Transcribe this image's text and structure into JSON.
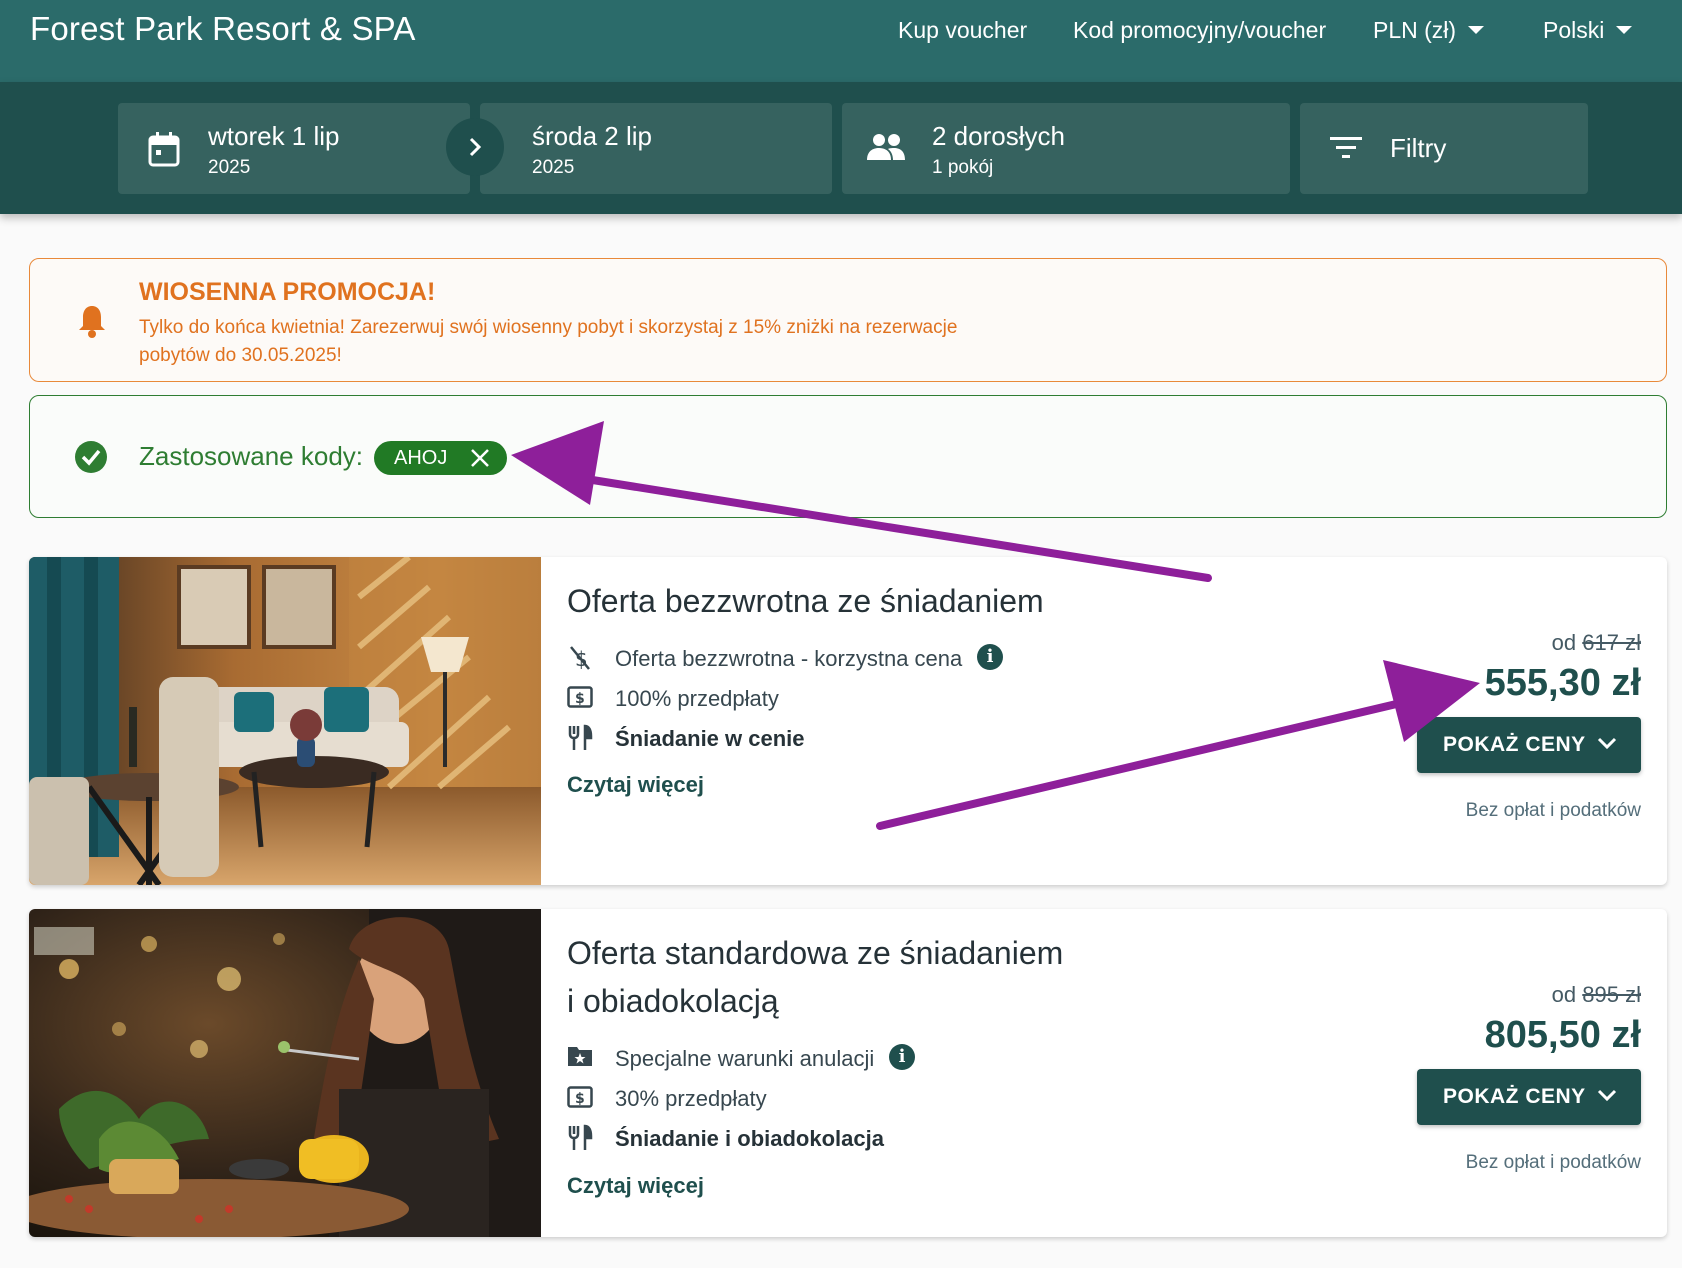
{
  "header": {
    "brand": "Forest Park Resort & SPA",
    "links": [
      "Kup voucher",
      "Kod promocyjny/voucher"
    ],
    "currency": "PLN (zł)",
    "language": "Polski"
  },
  "search": {
    "checkin_day": "wtorek 1 lip",
    "checkin_year": "2025",
    "checkout_day": "środa 2 lip",
    "checkout_year": "2025",
    "guests": "2 dorosłych",
    "rooms": "1 pokój",
    "filters": "Filtry"
  },
  "promo": {
    "title": "WIOSENNA PROMOCJA!",
    "text": "Tylko do końca kwietnia! Zarezerwuj swój wiosenny pobyt i skorzystaj z 15% zniżki na rezerwacje pobytów do 30.05.2025!",
    "color": "#e0721f"
  },
  "codes": {
    "label": "Zastosowane kody:",
    "chip": "AHOJ",
    "color": "#2e7d32"
  },
  "offers": [
    {
      "title": "Oferta bezzwrotna ze śniadaniem",
      "features": [
        {
          "icon": "no-refund-icon",
          "text": "Oferta bezzwrotna - korzystna cena",
          "info": "i"
        },
        {
          "icon": "prepayment-icon",
          "text": "100% przedpłaty"
        },
        {
          "icon": "cutlery-icon",
          "text": "Śniadanie w cenie"
        }
      ],
      "read_more": "Czytaj więcej",
      "from_label": "od",
      "old_price": "617 zł",
      "price": "555,30 zł",
      "button": "POKAŻ CENY",
      "tax_note": "Bez opłat i podatków"
    },
    {
      "title_line1": "Oferta standardowa ze śniadaniem",
      "title_line2": "i obiadokolacją",
      "features": [
        {
          "icon": "star-folder-icon",
          "text": "Specjalne warunki anulacji",
          "info": "i"
        },
        {
          "icon": "prepayment-icon",
          "text": "30% przedpłaty"
        },
        {
          "icon": "cutlery-icon",
          "text": "Śniadanie i obiadokolacja"
        }
      ],
      "read_more": "Czytaj więcej",
      "from_label": "od",
      "old_price": "895 zł",
      "price": "805,50 zł",
      "button": "POKAŻ CENY",
      "tax_note": "Bez opłat i podatków"
    }
  ],
  "colors": {
    "header": "#2b6b6a",
    "searchbar": "#1f4f4d",
    "accent": "#1f4f4d",
    "annotation_arrow": "#8e1f9a"
  }
}
